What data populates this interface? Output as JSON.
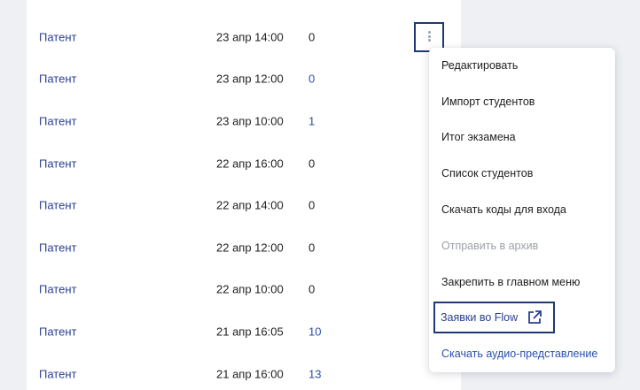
{
  "rows": [
    {
      "type": "Патент",
      "datetime": "23 апр 14:00",
      "count": "0",
      "count_link": false
    },
    {
      "type": "Патент",
      "datetime": "23 апр 12:00",
      "count": "0",
      "count_link": true
    },
    {
      "type": "Патент",
      "datetime": "23 апр 10:00",
      "count": "1",
      "count_link": true
    },
    {
      "type": "Патент",
      "datetime": "22 апр 16:00",
      "count": "0",
      "count_link": false
    },
    {
      "type": "Патент",
      "datetime": "22 апр 14:00",
      "count": "0",
      "count_link": false
    },
    {
      "type": "Патент",
      "datetime": "22 апр 12:00",
      "count": "0",
      "count_link": false
    },
    {
      "type": "Патент",
      "datetime": "22 апр 10:00",
      "count": "0",
      "count_link": false
    },
    {
      "type": "Патент",
      "datetime": "21 апр 16:05",
      "count": "10",
      "count_link": true
    },
    {
      "type": "Патент",
      "datetime": "21 апр 16:00",
      "count": "13",
      "count_link": true
    }
  ],
  "menu": {
    "edit": "Редактировать",
    "import_students": "Импорт студентов",
    "exam_result": "Итог экзамена",
    "student_list": "Список студентов",
    "download_codes": "Скачать коды для входа",
    "archive": "Отправить в архив",
    "pin_main_menu": "Закрепить в главном меню",
    "flow_requests": "Заявки во Flow",
    "download_audio": "Скачать аудио-представление"
  },
  "colors": {
    "accent_link": "#2a4fb0",
    "highlight_border": "#1e3a6e",
    "disabled_text": "#9a9fa8"
  },
  "icons": {
    "row_actions": "more-vertical-icon",
    "external_link": "external-link-icon"
  }
}
